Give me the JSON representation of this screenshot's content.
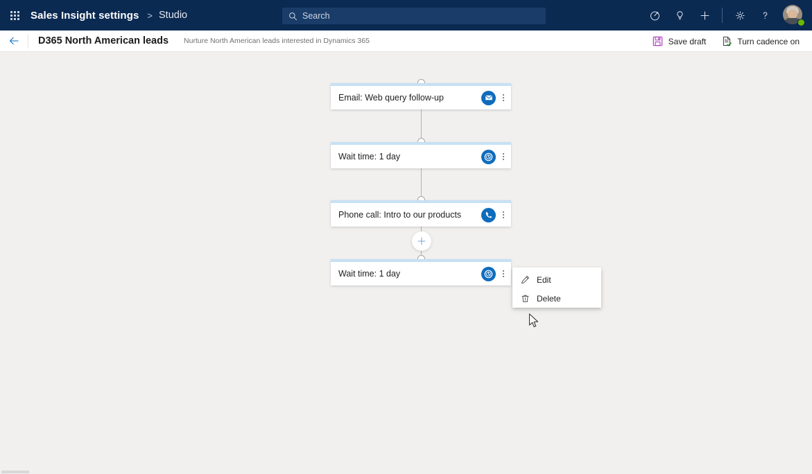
{
  "topnav": {
    "waffle_label": "app-launcher",
    "brand": "Sales Insight settings",
    "separator": ">",
    "sub_brand": "Studio",
    "search": {
      "placeholder": "Search",
      "value": ""
    },
    "icons": [
      {
        "name": "tasks-icon",
        "glyph": "task"
      },
      {
        "name": "lightbulb-icon",
        "glyph": "bulb"
      },
      {
        "name": "add-icon",
        "glyph": "plus"
      },
      {
        "name": "settings-gear-icon",
        "glyph": "gear"
      },
      {
        "name": "help-icon",
        "glyph": "question"
      }
    ],
    "avatar": {
      "name": "user-avatar",
      "presence": "available",
      "presence_color": "#6bb700"
    }
  },
  "commandbar": {
    "back_label": "Back",
    "title": "D365 North American leads",
    "subtitle": "Nurture North American leads interested in Dynamics 365",
    "actions": [
      {
        "name": "save-draft-button",
        "label": "Save draft",
        "icon": "save-icon",
        "icon_color": "#b146c2"
      },
      {
        "name": "turn-cadence-on-button",
        "label": "Turn cadence on",
        "icon": "page-check-icon",
        "icon_color": "#107c10"
      }
    ]
  },
  "canvas": {
    "accent_top_border": "#c7e0f4",
    "badge_color": "#0f6cbd",
    "connector_color": "#b3b3b3",
    "background": "#f1f0ef",
    "steps": [
      {
        "name": "step-card-email",
        "label": "Email: Web query follow-up",
        "icon": "envelope-icon",
        "more_label": "More options"
      },
      {
        "name": "step-card-wait-1",
        "label": "Wait time: 1 day",
        "icon": "clock-icon",
        "more_label": "More options"
      },
      {
        "name": "step-card-phone-call",
        "label": "Phone call: Intro to our products",
        "icon": "phone-icon",
        "more_label": "More options"
      },
      {
        "name": "step-card-wait-2",
        "label": "Wait time: 1 day",
        "icon": "clock-icon",
        "more_label": "More options"
      }
    ],
    "add_step": {
      "name": "add-step-button",
      "label": "Add step"
    }
  },
  "context_menu": {
    "items": [
      {
        "name": "context-menu-edit",
        "label": "Edit",
        "icon": "pencil-icon"
      },
      {
        "name": "context-menu-delete",
        "label": "Delete",
        "icon": "trash-icon"
      }
    ]
  }
}
